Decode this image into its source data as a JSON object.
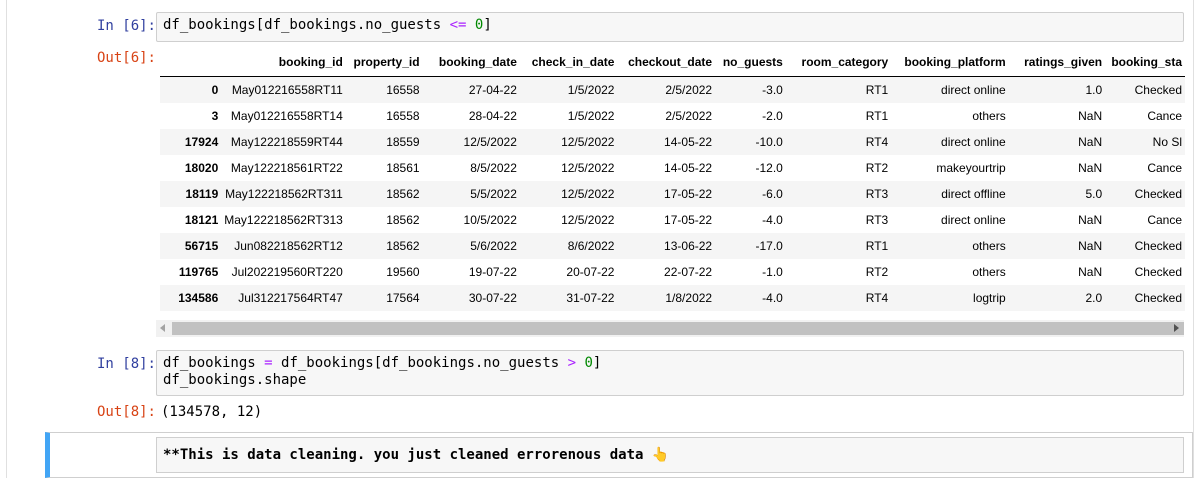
{
  "cell6": {
    "in_prompt": "In [6]:",
    "out_prompt": "Out[6]:",
    "code": {
      "pre": "df_bookings[df_bookings.no_guests ",
      "op": "<=",
      "sp": " ",
      "num": "0",
      "post": "]"
    }
  },
  "dataframe": {
    "columns": [
      "",
      "booking_id",
      "property_id",
      "booking_date",
      "check_in_date",
      "checkout_date",
      "no_guests",
      "room_category",
      "booking_platform",
      "ratings_given",
      "booking_sta"
    ],
    "rows": [
      [
        "0",
        "May012216558RT11",
        "16558",
        "27-04-22",
        "1/5/2022",
        "2/5/2022",
        "-3.0",
        "RT1",
        "direct online",
        "1.0",
        "Checked"
      ],
      [
        "3",
        "May012216558RT14",
        "16558",
        "28-04-22",
        "1/5/2022",
        "2/5/2022",
        "-2.0",
        "RT1",
        "others",
        "NaN",
        "Cance"
      ],
      [
        "17924",
        "May122218559RT44",
        "18559",
        "12/5/2022",
        "12/5/2022",
        "14-05-22",
        "-10.0",
        "RT4",
        "direct online",
        "NaN",
        "No Sl"
      ],
      [
        "18020",
        "May122218561RT22",
        "18561",
        "8/5/2022",
        "12/5/2022",
        "14-05-22",
        "-12.0",
        "RT2",
        "makeyourtrip",
        "NaN",
        "Cance"
      ],
      [
        "18119",
        "May122218562RT311",
        "18562",
        "5/5/2022",
        "12/5/2022",
        "17-05-22",
        "-6.0",
        "RT3",
        "direct offline",
        "5.0",
        "Checked"
      ],
      [
        "18121",
        "May122218562RT313",
        "18562",
        "10/5/2022",
        "12/5/2022",
        "17-05-22",
        "-4.0",
        "RT3",
        "direct online",
        "NaN",
        "Cance"
      ],
      [
        "56715",
        "Jun082218562RT12",
        "18562",
        "5/6/2022",
        "8/6/2022",
        "13-06-22",
        "-17.0",
        "RT1",
        "others",
        "NaN",
        "Checked"
      ],
      [
        "119765",
        "Jul202219560RT220",
        "19560",
        "19-07-22",
        "20-07-22",
        "22-07-22",
        "-1.0",
        "RT2",
        "others",
        "NaN",
        "Checked"
      ],
      [
        "134586",
        "Jul312217564RT47",
        "17564",
        "30-07-22",
        "31-07-22",
        "1/8/2022",
        "-4.0",
        "RT4",
        "logtrip",
        "2.0",
        "Checked"
      ]
    ]
  },
  "cell8": {
    "in_prompt": "In [8]:",
    "out_prompt": "Out[8]:",
    "line1": {
      "a": "df_bookings ",
      "eq": "=",
      "b": " df_bookings[df_bookings.no_guests ",
      "op": ">",
      "sp": " ",
      "num": "0",
      "post": "]"
    },
    "line2": "df_bookings.shape",
    "output": "(134578, 12)"
  },
  "markdown": {
    "text": "**This is data cleaning. you just cleaned errorenous data",
    "emoji_icon": "pointing-hand-icon"
  }
}
